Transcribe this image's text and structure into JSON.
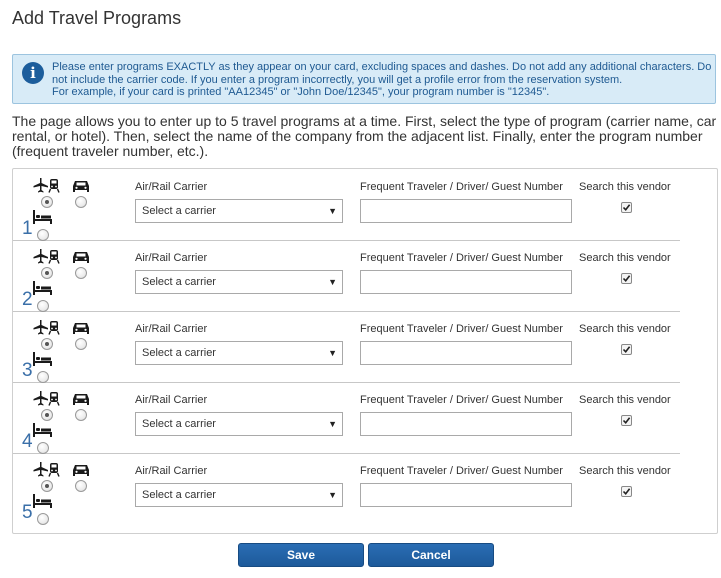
{
  "page": {
    "title": "Add Travel Programs"
  },
  "info": {
    "icon": "info-icon",
    "line1": "Please enter programs EXACTLY as they appear on your card, excluding spaces and dashes. Do not add any additional characters. Do",
    "line2": "not include the carrier code. If you enter a program incorrectly, you will get a profile error from the reservation system.",
    "line3": "For example, if your card is printed \"AA12345\" or \"John Doe/12345\", your program number is \"12345\"."
  },
  "intro": "The page allows you to enter up to 5 travel programs at a time. First, select the type of program (carrier name, car rental, or hotel). Then, select the name of the company from the adjacent list. Finally, enter the program number (frequent traveler number, etc.).",
  "rows": [
    {
      "number": "1",
      "carrier_label": "Air/Rail Carrier",
      "carrier_value": "Select a carrier",
      "number_label": "Frequent Traveler / Driver/ Guest Number",
      "number_value": "",
      "search_label": "Search this vendor",
      "search_checked": true,
      "selected_type": "air-rail"
    },
    {
      "number": "2",
      "carrier_label": "Air/Rail Carrier",
      "carrier_value": "Select a carrier",
      "number_label": "Frequent Traveler / Driver/ Guest Number",
      "number_value": "",
      "search_label": "Search this vendor",
      "search_checked": true,
      "selected_type": "air-rail"
    },
    {
      "number": "3",
      "carrier_label": "Air/Rail Carrier",
      "carrier_value": "Select a carrier",
      "number_label": "Frequent Traveler / Driver/ Guest Number",
      "number_value": "",
      "search_label": "Search this vendor",
      "search_checked": true,
      "selected_type": "air-rail"
    },
    {
      "number": "4",
      "carrier_label": "Air/Rail Carrier",
      "carrier_value": "Select a carrier",
      "number_label": "Frequent Traveler / Driver/ Guest Number",
      "number_value": "",
      "search_label": "Search this vendor",
      "search_checked": true,
      "selected_type": "air-rail"
    },
    {
      "number": "5",
      "carrier_label": "Air/Rail Carrier",
      "carrier_value": "Select a carrier",
      "number_label": "Frequent Traveler / Driver/ Guest Number",
      "number_value": "",
      "search_label": "Search this vendor",
      "search_checked": true,
      "selected_type": "air-rail"
    }
  ],
  "type_icons": [
    "airplane-train-icon",
    "car-icon",
    "hotel-bed-icon"
  ],
  "buttons": {
    "save_label": "Save",
    "cancel_label": "Cancel"
  },
  "colors": {
    "accent": "#1f63a8",
    "info_background": "#d8ebf7",
    "info_text": "#1f5a92"
  }
}
